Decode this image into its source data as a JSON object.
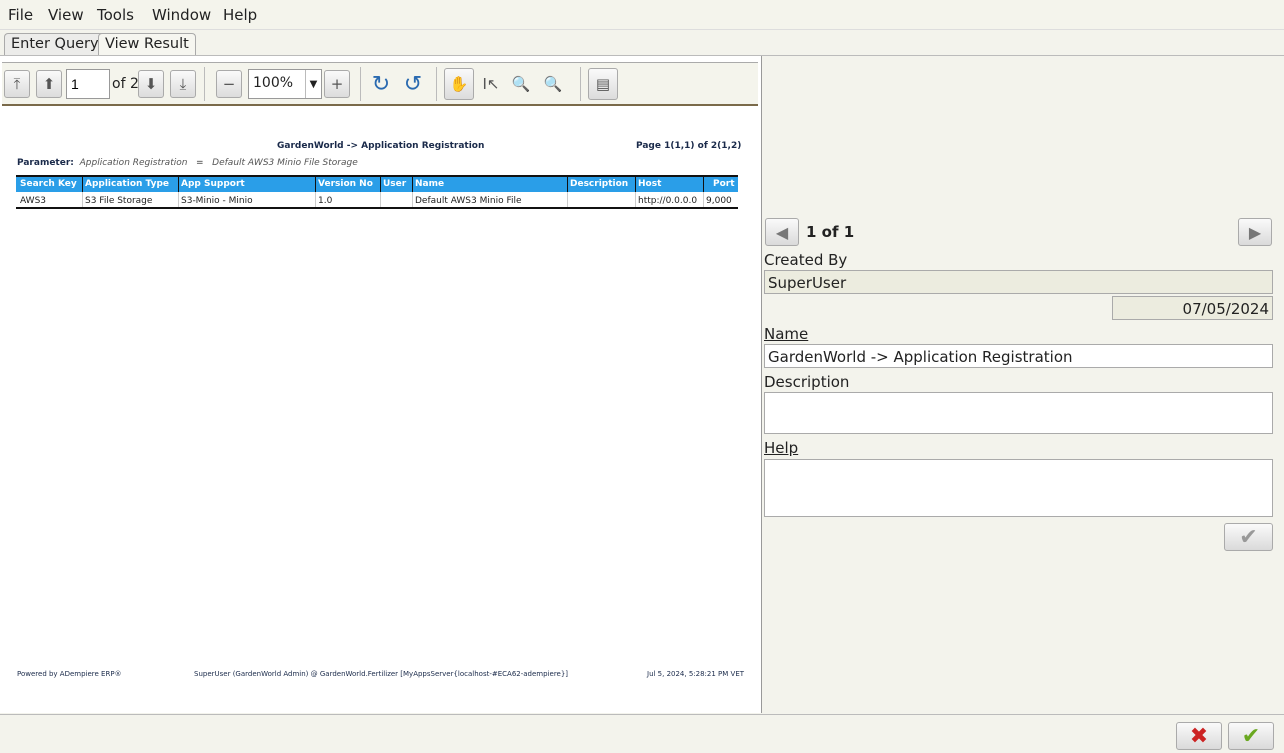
{
  "menu": {
    "file": "File",
    "view": "View",
    "tools": "Tools",
    "window": "Window",
    "help": "Help"
  },
  "tabs": {
    "enter_query": "Enter Query",
    "view_result": "View Result"
  },
  "toolbar": {
    "page_value": "1",
    "of_label": "of 2",
    "zoom_value": "100%"
  },
  "report": {
    "title": "GardenWorld -> Application Registration",
    "page_info": "Page 1(1,1) of 2(1,2)",
    "parameter_label": "Parameter:",
    "parameter_name": "Application Registration",
    "parameter_eq": "=",
    "parameter_value": "Default AWS3 Minio File Storage",
    "columns": [
      "Search Key",
      "Application Type",
      "App Support",
      "Version No",
      "User",
      "Name",
      "Description",
      "Host",
      "Port"
    ],
    "rows": [
      [
        "AWS3",
        "S3 File Storage",
        "S3-Minio - Minio",
        "1.0",
        "",
        "Default AWS3 Minio File",
        "",
        "http://0.0.0.0",
        "9,000"
      ]
    ],
    "footer_left": "Powered by ADempiere ERP®",
    "footer_center": "SuperUser (GardenWorld Admin) @ GardenWorld.Fertilizer [MyAppsServer{localhost-#ECA62-adempiere}]",
    "footer_right": "Jul 5, 2024, 5:28:21 PM VET"
  },
  "record_nav": {
    "label": "1 of 1"
  },
  "form": {
    "created_by_label": "Created By",
    "created_by_value": "SuperUser",
    "created_date": "07/05/2024",
    "name_label": "Name",
    "name_value": "GardenWorld -> Application Registration",
    "description_label": "Description",
    "description_value": "",
    "help_label": "Help",
    "help_value": ""
  },
  "colors": {
    "header_blue": "#2a9ee8",
    "cancel_red": "#cc2222",
    "ok_green": "#6aa820"
  }
}
